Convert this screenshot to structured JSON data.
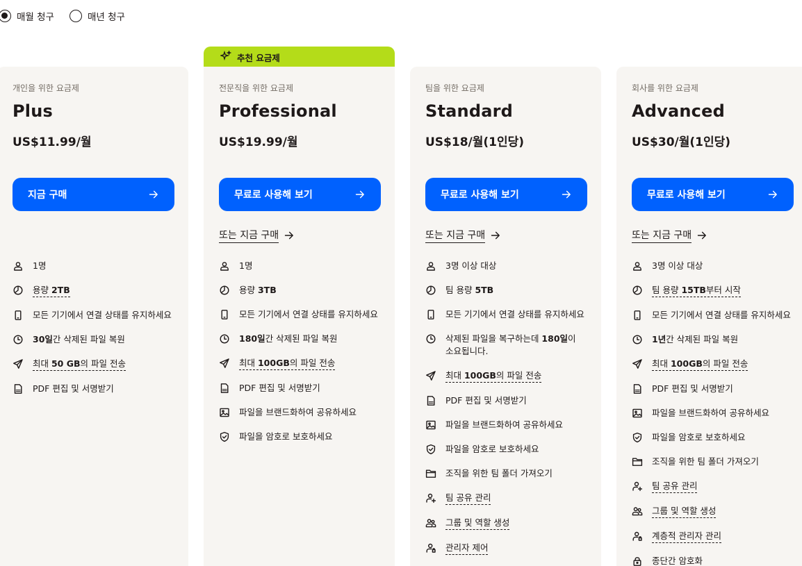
{
  "billing": {
    "monthly": "매월 청구",
    "yearly": "매년 청구"
  },
  "badge": "추천 요금제",
  "common": {
    "or_buy": "또는 지금 구매"
  },
  "plans": [
    {
      "audience": "개인을 위한 요금제",
      "name": "Plus",
      "price": "US$11.99/월",
      "cta": "지금 구매",
      "features": [
        {
          "icon": "user-icon",
          "text": "1명"
        },
        {
          "icon": "storage-icon",
          "text": "용량 2TB"
        },
        {
          "icon": "device-icon",
          "text": "모든 기기에서 연결 상태를 유지하세요"
        },
        {
          "icon": "restore-icon",
          "text": "30일간 삭제된 파일 복원"
        },
        {
          "icon": "send-icon",
          "text": "최대 50 GB의 파일 전송"
        },
        {
          "icon": "pdf-icon",
          "text": "PDF 편집 및 서명받기"
        }
      ]
    },
    {
      "audience": "전문직을 위한 요금제",
      "name": "Professional",
      "price": "US$19.99/월",
      "cta": "무료로 사용해 보기",
      "features": [
        {
          "icon": "user-icon",
          "text": "1명"
        },
        {
          "icon": "storage-icon",
          "text": "용량 3TB"
        },
        {
          "icon": "device-icon",
          "text": "모든 기기에서 연결 상태를 유지하세요"
        },
        {
          "icon": "restore-icon",
          "text": "180일간 삭제된 파일 복원"
        },
        {
          "icon": "send-icon",
          "text": "최대 100GB의 파일 전송"
        },
        {
          "icon": "pdf-icon",
          "text": "PDF 편집 및 서명받기"
        },
        {
          "icon": "image-icon",
          "text": "파일을 브랜드화하여 공유하세요"
        },
        {
          "icon": "shield-icon",
          "text": "파일을 암호로 보호하세요"
        }
      ]
    },
    {
      "audience": "팀을 위한 요금제",
      "name": "Standard",
      "price": "US$18/월(1인당)",
      "cta": "무료로 사용해 보기",
      "features": [
        {
          "icon": "user-icon",
          "text": "3명 이상 대상"
        },
        {
          "icon": "storage-icon",
          "text": "팀 용량 5TB"
        },
        {
          "icon": "device-icon",
          "text": "모든 기기에서 연결 상태를 유지하세요"
        },
        {
          "icon": "restore-icon",
          "text": "삭제된 파일을 복구하는데 180일이 소요됩니다."
        },
        {
          "icon": "send-icon",
          "text": "최대 100GB의 파일 전송"
        },
        {
          "icon": "pdf-icon",
          "text": "PDF 편집 및 서명받기"
        },
        {
          "icon": "image-icon",
          "text": "파일을 브랜드화하여 공유하세요"
        },
        {
          "icon": "shield-icon",
          "text": "파일을 암호로 보호하세요"
        },
        {
          "icon": "folder-icon",
          "text": "조직을 위한 팀 폴더 가져오기"
        },
        {
          "icon": "user-add-icon",
          "text": "팀 공유 관리"
        },
        {
          "icon": "group-icon",
          "text": "그룹 및 역할 생성"
        },
        {
          "icon": "admin-icon",
          "text": "관리자 제어"
        }
      ]
    },
    {
      "audience": "회사를 위한 요금제",
      "name": "Advanced",
      "price": "US$30/월(1인당)",
      "cta": "무료로 사용해 보기",
      "features": [
        {
          "icon": "user-icon",
          "text": "3명 이상 대상"
        },
        {
          "icon": "storage-icon",
          "text": "팀 용량 15TB부터 시작"
        },
        {
          "icon": "device-icon",
          "text": "모든 기기에서 연결 상태를 유지하세요"
        },
        {
          "icon": "restore-icon",
          "text": "1년간 삭제된 파일 복원"
        },
        {
          "icon": "send-icon",
          "text": "최대 100GB의 파일 전송"
        },
        {
          "icon": "pdf-icon",
          "text": "PDF 편집 및 서명받기"
        },
        {
          "icon": "image-icon",
          "text": "파일을 브랜드화하여 공유하세요"
        },
        {
          "icon": "shield-icon",
          "text": "파일을 암호로 보호하세요"
        },
        {
          "icon": "folder-icon",
          "text": "조직을 위한 팀 폴더 가져오기"
        },
        {
          "icon": "user-add-icon",
          "text": "팀 공유 관리"
        },
        {
          "icon": "group-icon",
          "text": "그룹 및 역할 생성"
        },
        {
          "icon": "admin-icon",
          "text": "계층적 관리자 관리"
        },
        {
          "icon": "lock-icon",
          "text": "종단간 암호화"
        }
      ]
    }
  ]
}
